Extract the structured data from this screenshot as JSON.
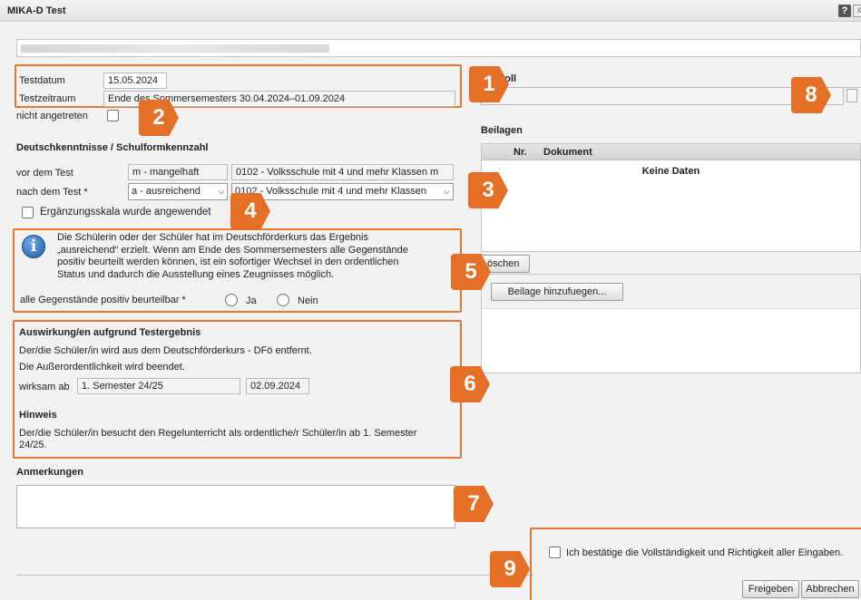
{
  "window": {
    "title": "MIKA-D Test",
    "help": "?",
    "close": "x"
  },
  "test": {
    "date_label": "Testdatum",
    "date_value": "15.05.2024",
    "period_label": "Testzeitraum",
    "period_value": "Ende des Sommersemesters 30.04.2024–01.09.2024",
    "absent_label": "nicht angetreten"
  },
  "skills": {
    "heading": "Deutschkenntnisse / Schulformkennzahl",
    "before_label": "vor dem Test",
    "before_grade": "m - mangelhaft",
    "before_school": "0102 - Volksschule mit 4 und mehr Klassen m",
    "after_label": "nach dem Test *",
    "after_grade": "a - ausreichend",
    "after_school": "0102 - Volksschule mit 4 und mehr Klassen",
    "supplement_label": "Ergänzungsskala wurde angewendet"
  },
  "info": {
    "text_1": "Die Schülerin oder der Schüler hat im Deutschförderkurs das Ergebnis",
    "text_2": "„ausreichend“ erzielt. Wenn am Ende des Sommersemesters alle Gegenstände",
    "text_3": "positiv beurteilt werden können, ist ein sofortiger Wechsel in den ordentlichen",
    "text_4": "Status und dadurch die Ausstellung eines Zeugnisses möglich.",
    "question": "alle Gegenstände positiv beurteilbar *",
    "yes": "Ja",
    "no": "Nein"
  },
  "result": {
    "heading": "Auswirkung/en aufgrund Testergebnis",
    "line_1": "Der/die Schüler/in wird aus dem Deutschförderkurs - DFö entfernt.",
    "line_2": "Die Außerordentlichkeit wird beendet.",
    "effective_label": "wirksam ab",
    "effective_semester": "1. Semester 24/25",
    "effective_date": "02.09.2024",
    "note_heading": "Hinweis",
    "note_1": "Der/die Schüler/in besucht den Regelunterricht als ordentliche/r Schüler/in ab 1. Semester",
    "note_2": "24/25."
  },
  "remarks": {
    "label": "Anmerkungen"
  },
  "protocol": {
    "label": "Protokoll",
    "label_visible": "otokoll"
  },
  "attachments": {
    "label": "Beilagen",
    "col_nr": "Nr.",
    "col_doc": "Dokument",
    "empty": "Keine Daten",
    "delete_button": "öschen",
    "add_button": "Beilage hinzufuegen..."
  },
  "confirm": {
    "label": "Ich bestätige die Vollständigkeit und Richtigkeit aller Eingaben.",
    "release_button": "Freigeben",
    "cancel_button": "Abbrechen"
  },
  "badges": [
    "1",
    "2",
    "3",
    "4",
    "5",
    "6",
    "7",
    "8",
    "9"
  ],
  "colors": {
    "accent": "#e56f26",
    "info_icon": "#1d5fa8"
  }
}
